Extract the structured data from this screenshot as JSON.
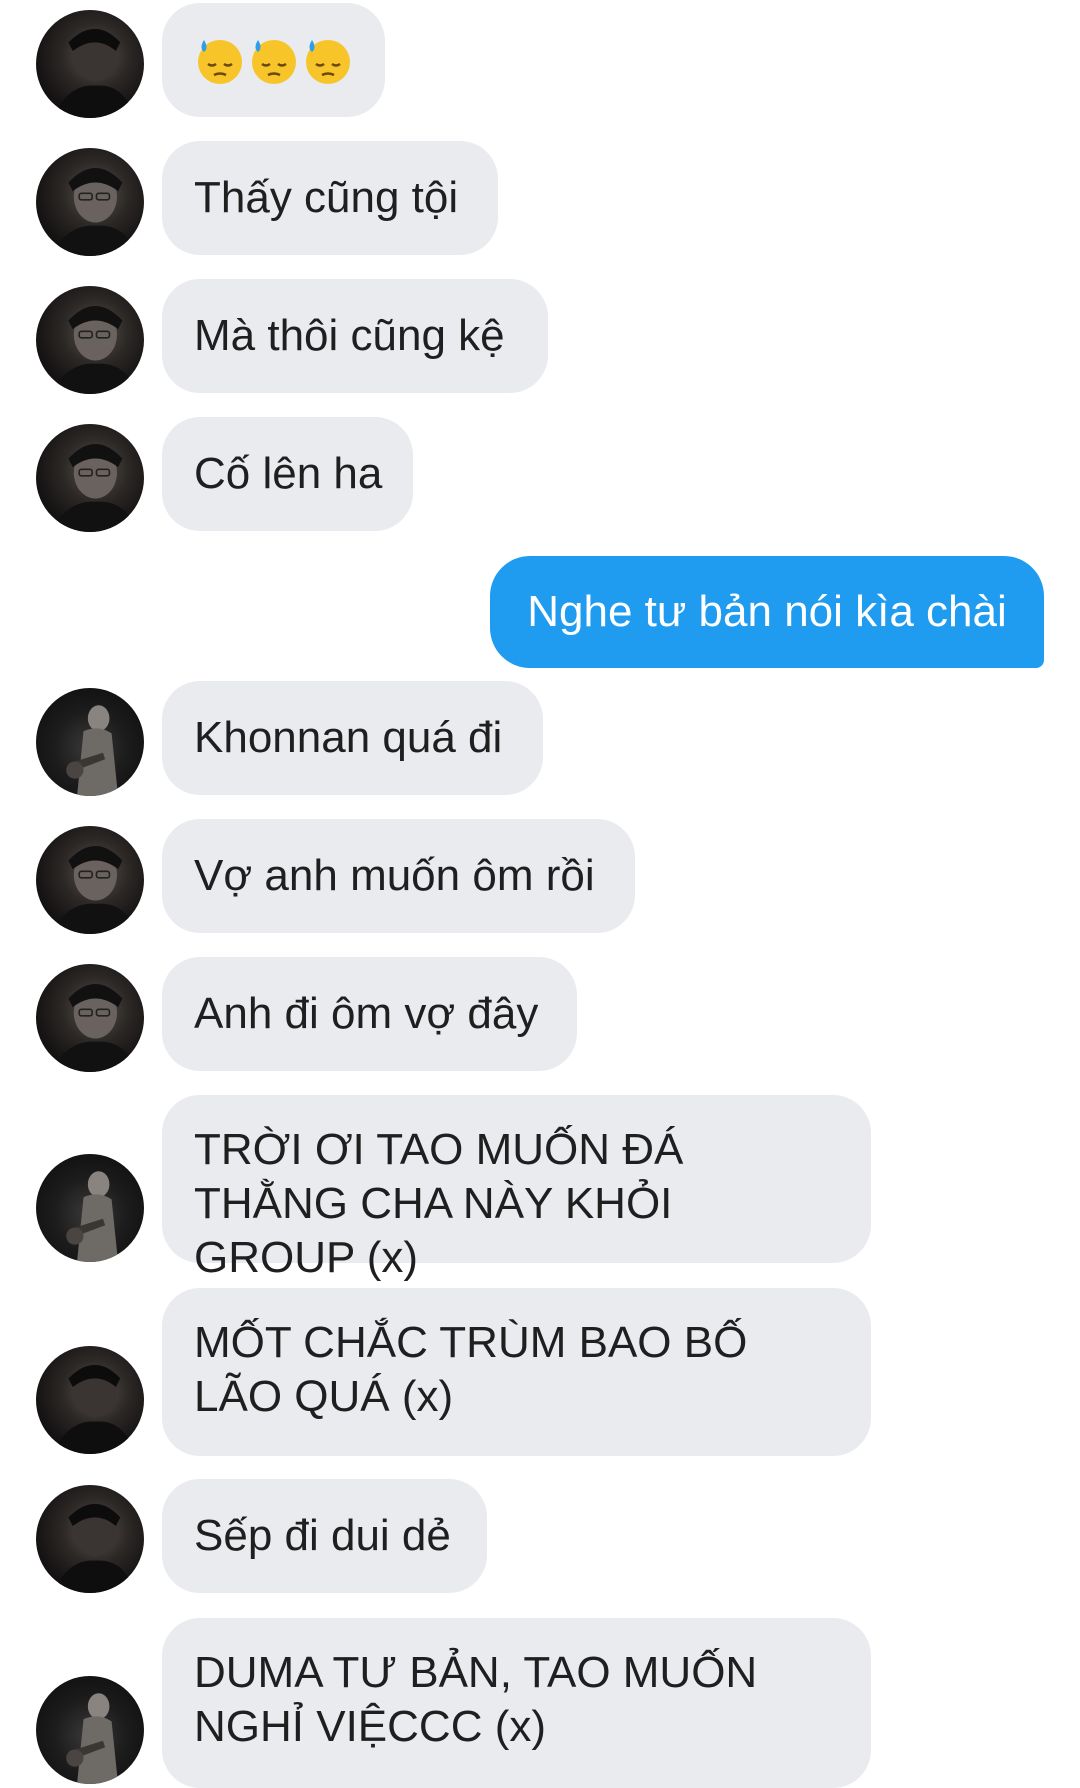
{
  "conversation": {
    "messages": [
      {
        "side": "them",
        "text": "😓😓😓",
        "avatar": "portrait"
      },
      {
        "side": "them",
        "text": "Thấy cũng tội",
        "avatar": "portrait"
      },
      {
        "side": "them",
        "text": "Mà thôi cũng kệ",
        "avatar": "portrait"
      },
      {
        "side": "them",
        "text": "Cố lên ha",
        "avatar": "portrait"
      },
      {
        "side": "me",
        "text": "Nghe tư bản nói kìa chài"
      },
      {
        "side": "them",
        "text": "Khonnan quá đi",
        "avatar": "guitar"
      },
      {
        "side": "them",
        "text": "Vợ anh muốn ôm rồi",
        "avatar": "portrait"
      },
      {
        "side": "them",
        "text": "Anh đi ôm vợ đây",
        "avatar": "portrait"
      },
      {
        "side": "them",
        "text": "TRỜI ƠI TAO MUỐN ĐÁ THẰNG CHA NÀY KHỎI GROUP (x)",
        "avatar": "guitar"
      },
      {
        "side": "them",
        "text": "MỐT CHẮC TRÙM BAO BỐ LÃO QUÁ (x)",
        "avatar": "portrait-dark"
      },
      {
        "side": "them",
        "text": "Sếp đi dui dẻ",
        "avatar": "portrait-dark"
      },
      {
        "side": "them",
        "text": "DUMA TƯ BẢN, TAO MUỐN NGHỈ VIỆCCC (x)",
        "avatar": "guitar"
      }
    ]
  },
  "colors": {
    "incoming_bubble": "#e9ebef",
    "outgoing_bubble": "#1f9cf0",
    "background": "#ffffff"
  },
  "icons": {
    "sweat_emoji": "downcast-face-with-sweat-icon"
  }
}
